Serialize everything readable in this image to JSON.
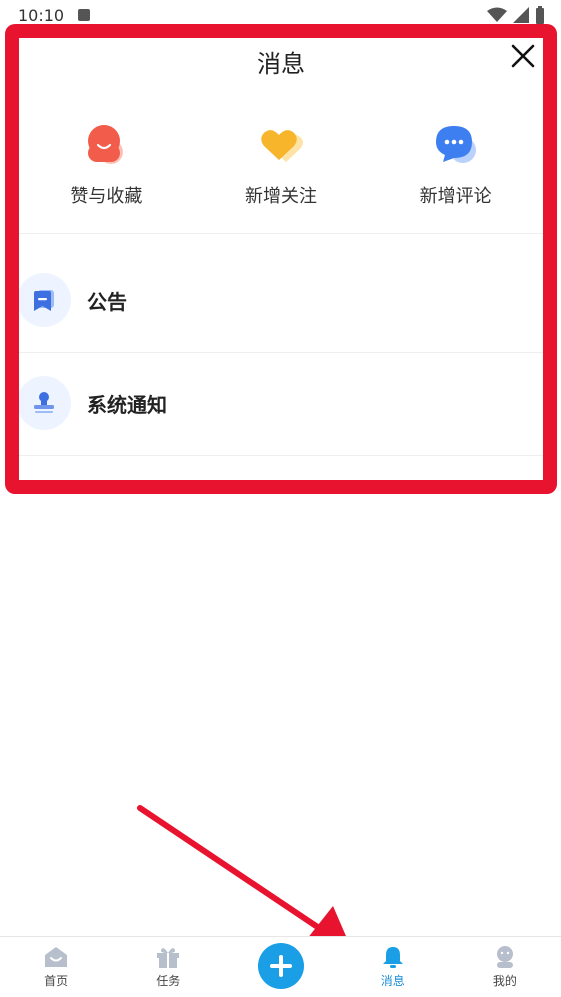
{
  "status_bar": {
    "time": "10:10"
  },
  "panel": {
    "title": "消息",
    "quick_actions": [
      {
        "label": "赞与收藏",
        "icon": "like-collect-icon",
        "color": "#f25c4b"
      },
      {
        "label": "新增关注",
        "icon": "heart-icon",
        "color": "#f7b52b"
      },
      {
        "label": "新增评论",
        "icon": "comment-icon",
        "color": "#3d7ef0"
      }
    ],
    "list": [
      {
        "label": "公告",
        "icon": "announcement-icon"
      },
      {
        "label": "系统通知",
        "icon": "system-notice-icon"
      }
    ]
  },
  "bottom_nav": {
    "items": [
      {
        "label": "首页",
        "icon": "home-icon"
      },
      {
        "label": "任务",
        "icon": "gift-icon"
      },
      {
        "label": "消息",
        "icon": "bell-icon",
        "active": true
      },
      {
        "label": "我的",
        "icon": "profile-icon"
      }
    ],
    "accent": "#1a9ee6"
  },
  "annotation_color": "#e8132f"
}
